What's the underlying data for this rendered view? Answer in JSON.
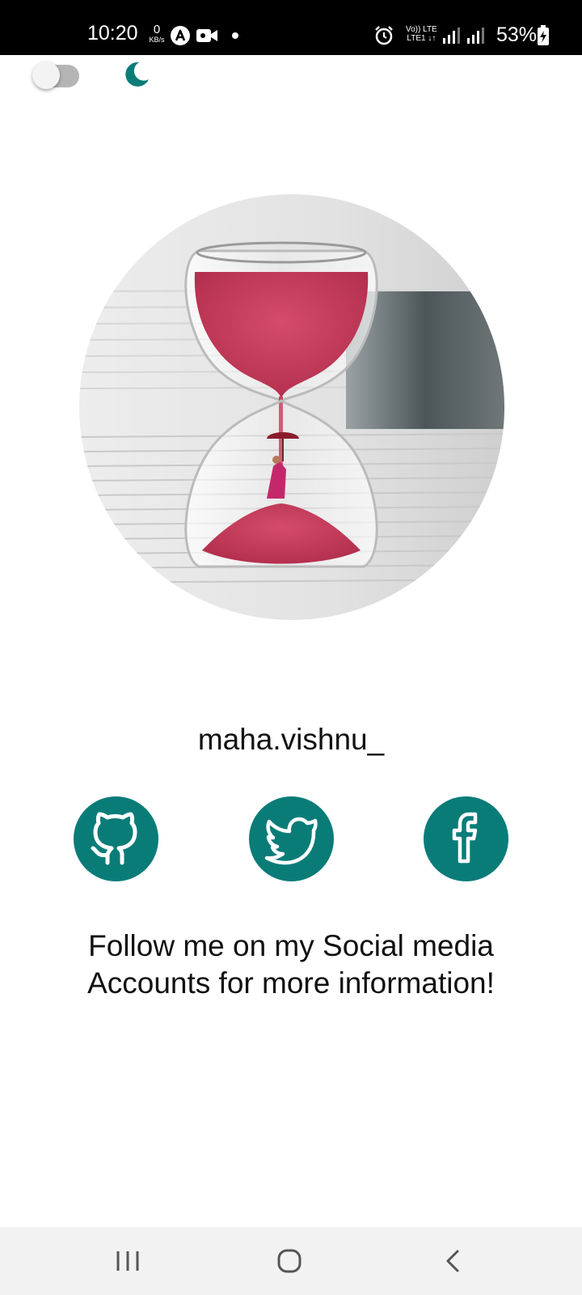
{
  "status_bar": {
    "time": "10:20",
    "net_speed_value": "0",
    "net_speed_unit": "KB/s",
    "volte_label_line1": "Vo)) LTE",
    "volte_label_line2": "LTE1 ↓↑",
    "battery": "53%",
    "icons": [
      "app-a-icon",
      "video-camera-icon",
      "alarm-icon",
      "signal-icon",
      "battery-charging-icon"
    ]
  },
  "header": {
    "theme_toggle_state": "off",
    "moon_icon": "moon-icon",
    "accent_color": "#0a7c78"
  },
  "profile": {
    "photo_description_icon": "hourglass-photo",
    "username": "maha.vishnu_"
  },
  "social": [
    {
      "name": "GitHub",
      "icon": "github-icon"
    },
    {
      "name": "Twitter",
      "icon": "twitter-icon"
    },
    {
      "name": "Facebook",
      "icon": "facebook-icon"
    }
  ],
  "message": {
    "line1": "Follow me on my Social media",
    "line2": "Accounts for more information!"
  },
  "nav_bar": {
    "icons": [
      "recent-apps-icon",
      "home-icon",
      "back-icon"
    ]
  }
}
